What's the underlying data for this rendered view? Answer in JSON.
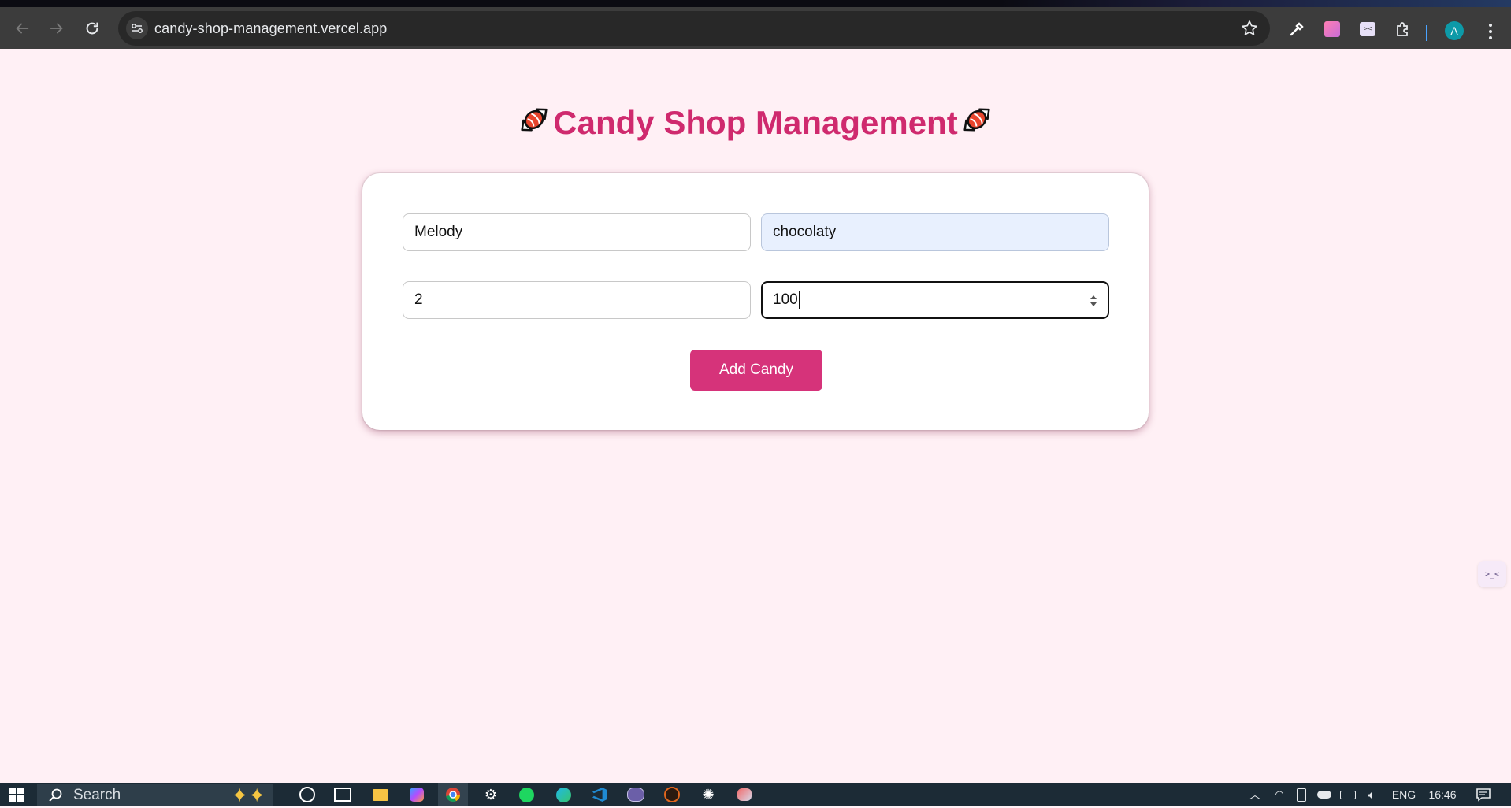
{
  "browser": {
    "url": "candy-shop-management.vercel.app",
    "avatar_letter": "A",
    "icons": [
      "back-arrow-icon",
      "forward-arrow-icon",
      "reload-icon",
      "site-info-icon",
      "bookmark-star-icon",
      "eyedropper-icon",
      "gradient-extension-icon",
      "terminal-extension-icon",
      "extensions-puzzle-icon",
      "profile-avatar",
      "more-menu-icon"
    ]
  },
  "page": {
    "title": "Candy Shop Management",
    "title_icon": "candy-icon",
    "colors": {
      "background": "#fff0f5",
      "accent": "#d6337a",
      "title": "#cf2a6e"
    },
    "form": {
      "name_value": "Melody",
      "category_value": "chocolaty",
      "price_value": "2",
      "quantity_value": "100",
      "submit_label": "Add Candy"
    },
    "side_widget_label": ">_<"
  },
  "taskbar": {
    "search_placeholder": "Search",
    "language": "ENG",
    "time": "16:46",
    "icons": [
      "windows-start-icon",
      "search-icon",
      "copilot-icon",
      "cortana-icon",
      "task-view-icon",
      "file-explorer-icon",
      "copilot-app-icon",
      "chrome-icon",
      "settings-icon",
      "spotify-icon",
      "edge-icon",
      "vscode-icon",
      "terminal-icon",
      "app-icon",
      "chatgpt-icon",
      "app2-icon",
      "tray-chevron-icon",
      "wifi-icon",
      "phone-link-icon",
      "onedrive-icon",
      "battery-icon",
      "volume-icon",
      "notifications-icon"
    ]
  }
}
